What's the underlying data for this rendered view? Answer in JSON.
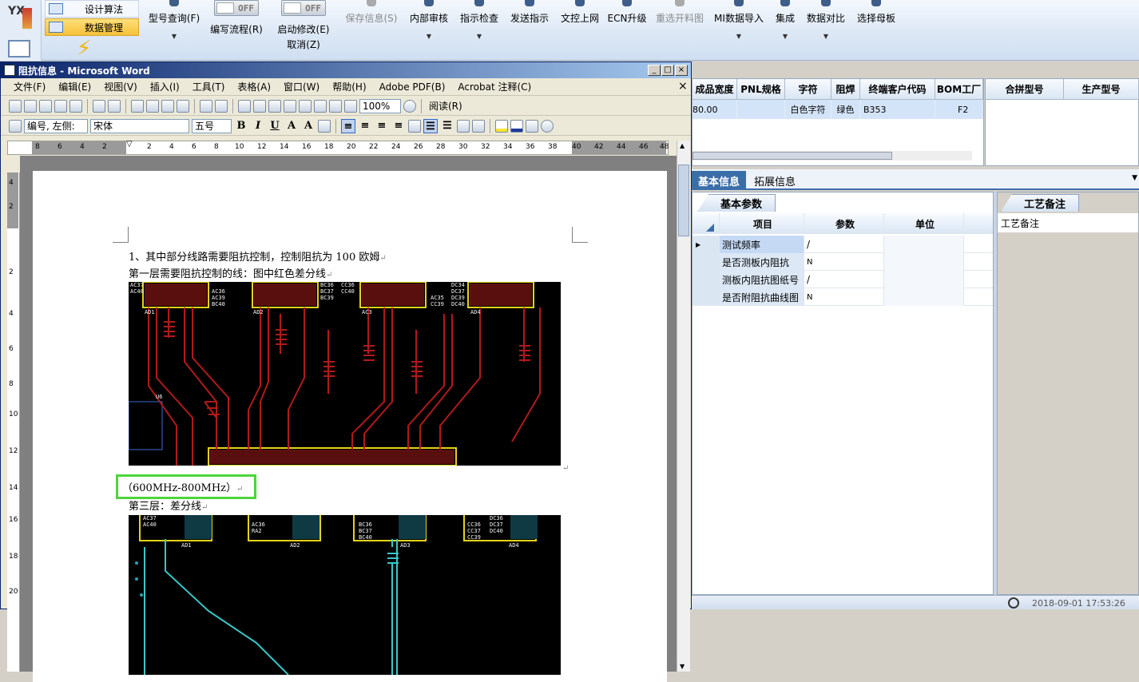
{
  "app": {
    "logo_text": "YX",
    "nav": [
      {
        "label": "设计算法",
        "active": false
      },
      {
        "label": "数据管理",
        "active": true
      }
    ]
  },
  "ribbon": {
    "buttons": [
      {
        "label": "型号查询(F)",
        "enabled": true
      },
      {
        "label": "编写流程(R)",
        "enabled": true,
        "toggle": "OFF"
      },
      {
        "label": "启动修改(E)",
        "sub": "取消(Z)",
        "enabled": true,
        "toggle": "OFF"
      },
      {
        "label": "保存信息(S)",
        "enabled": false
      },
      {
        "label": "内部审核",
        "enabled": true
      },
      {
        "label": "指示检查",
        "enabled": true
      },
      {
        "label": "发送指示",
        "enabled": true
      },
      {
        "label": "文控上网",
        "enabled": true
      },
      {
        "label": "ECN升级",
        "enabled": true
      },
      {
        "label": "重选开料图",
        "enabled": false
      },
      {
        "label": "MI数据导入",
        "enabled": true
      },
      {
        "label": "集成",
        "enabled": true
      },
      {
        "label": "数据对比",
        "enabled": true
      },
      {
        "label": "选择母板",
        "enabled": true
      }
    ]
  },
  "word": {
    "title": "阻抗信息 - Microsoft Word",
    "menu": [
      "文件(F)",
      "编辑(E)",
      "视图(V)",
      "插入(I)",
      "工具(T)",
      "表格(A)",
      "窗口(W)",
      "帮助(H)",
      "Adobe PDF(B)",
      "Acrobat 注释(C)"
    ],
    "zoom": "100%",
    "read_label": "阅读(R)",
    "style": "编号, 左侧:",
    "font": "宋体",
    "size": "五号",
    "ruler_h": [
      "8",
      "6",
      "4",
      "2",
      "",
      "2",
      "4",
      "6",
      "8",
      "10",
      "12",
      "14",
      "16",
      "18",
      "20",
      "22",
      "24",
      "26",
      "28",
      "30",
      "32",
      "34",
      "36",
      "38",
      "40",
      "42",
      "44",
      "46",
      "48"
    ],
    "ruler_v": [
      "4",
      "2",
      "",
      "2",
      "4",
      "6",
      "8",
      "10",
      "12",
      "14",
      "16",
      "18",
      "20"
    ],
    "doc": {
      "line1": "1、其中部分线路需要阻抗控制，控制阻抗为 100 欧姆",
      "line2": "第一层需要阻抗控制的线：图中红色差分线",
      "freq": "（600MHz-800MHz）",
      "line3": "第三层：差分线"
    },
    "pcb_labels_top": [
      "AD1",
      "AD2",
      "AC3",
      "AD4",
      "U6",
      "BC37",
      "BC39",
      "AC35",
      "CC39",
      "CC36",
      "BC36",
      "AC36",
      "AC39",
      "CC40",
      "DC34",
      "DC37",
      "DC39",
      "DC40",
      "AC37",
      "AC40",
      "BC40"
    ],
    "pcb_labels_bottom": [
      "AD1",
      "AD2",
      "AD3",
      "AD4",
      "AC36",
      "AC37",
      "AC40",
      "BC36",
      "BC37",
      "BC40",
      "CC36",
      "CC37",
      "CC39",
      "DC36",
      "DC37",
      "DC40",
      "RA2"
    ]
  },
  "grid_top": {
    "headers": [
      "成品宽度",
      "PNL规格",
      "字符",
      "阻焊",
      "终端客户代码",
      "BOM工厂"
    ],
    "row": [
      "80.00",
      "",
      "白色字符",
      "绿色",
      "B353",
      "F2"
    ],
    "right_headers": [
      "合拼型号",
      "生产型号"
    ]
  },
  "tabs": [
    "基本信息",
    "拓展信息"
  ],
  "basic": {
    "panel_title": "基本参数",
    "headers": [
      "项目",
      "参数",
      "单位"
    ],
    "rows": [
      {
        "item": "测试频率",
        "param": "/",
        "unit": ""
      },
      {
        "item": "是否测板内阻抗",
        "param": "N",
        "unit": ""
      },
      {
        "item": "测板内阻抗图纸号",
        "param": "/",
        "unit": ""
      },
      {
        "item": "是否附阻抗曲线图",
        "param": "N",
        "unit": ""
      }
    ]
  },
  "craft": {
    "panel_title": "工艺备注",
    "header": "工艺备注"
  },
  "status": {
    "datetime": "2018-09-01 17:53:26"
  },
  "colors": {
    "ribbon_bg": "#dbe7f5",
    "active_nav": "#f6c13a",
    "tab_active": "#3a6ea8",
    "highlight_box": "#4bd63a",
    "pcb_trace": "#b01a1a",
    "pcb_trace_l3": "#38c8c8",
    "pcb_pad": "#e5d316"
  }
}
